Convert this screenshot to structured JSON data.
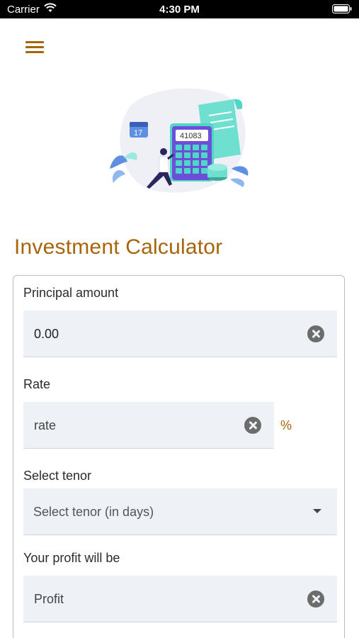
{
  "status_bar": {
    "carrier": "Carrier",
    "time": "4:30 PM"
  },
  "menu": {
    "icon": "hamburger-menu-icon"
  },
  "hero": {
    "calculator_display": "41083",
    "calendar_day": "17"
  },
  "page_title": "Investment Calculator",
  "form": {
    "principal": {
      "label": "Principal amount",
      "value": "0.00"
    },
    "rate": {
      "label": "Rate",
      "placeholder": "rate",
      "unit": "%"
    },
    "tenor": {
      "label": "Select tenor",
      "placeholder": "Select tenor (in days)"
    },
    "profit": {
      "label": "Your profit will be",
      "placeholder": "Profit"
    }
  },
  "colors": {
    "accent": "#a8640b",
    "input_bg": "#eef1f5",
    "illustration_teal": "#4fd6c6",
    "illustration_purple": "#6b4fd8"
  }
}
